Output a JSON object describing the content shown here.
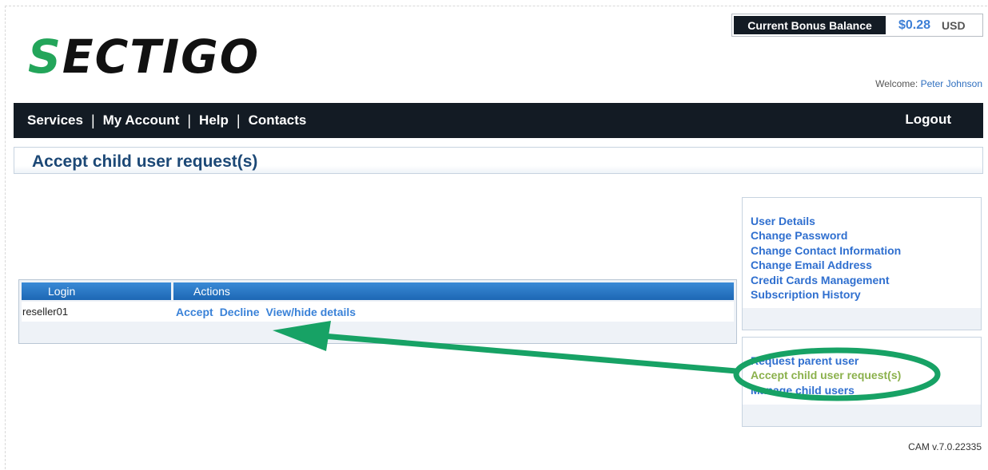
{
  "brand": {
    "logo_s": "S",
    "logo_rest": "ECTIGO",
    "accent": "#23a55a"
  },
  "bonus": {
    "label": "Current Bonus Balance",
    "amount": "$0.28",
    "currency": "USD"
  },
  "welcome": {
    "prefix": "Welcome: ",
    "user": "Peter Johnson"
  },
  "nav": {
    "items": [
      {
        "label": "Services"
      },
      {
        "label": "My Account"
      },
      {
        "label": "Help"
      },
      {
        "label": "Contacts"
      }
    ],
    "separator": "|",
    "logout": "Logout"
  },
  "page": {
    "title": "Accept child user request(s)"
  },
  "table": {
    "columns": [
      "Login",
      "Actions"
    ],
    "rows": [
      {
        "login": "reseller01",
        "actions": [
          "Accept",
          "Decline",
          "View/hide details"
        ]
      }
    ]
  },
  "sidebar": {
    "account_links": [
      "User Details",
      "Change Password",
      "Change Contact Information",
      "Change Email Address",
      "Credit Cards Management",
      "Subscription History"
    ],
    "user_links": [
      "Request parent user",
      "Accept child user request(s)",
      "Manage child users"
    ],
    "active_link_color": "#8bb14c"
  },
  "annotation": {
    "color": "#17a265"
  },
  "footer": {
    "version": "CAM v.7.0.22335"
  }
}
